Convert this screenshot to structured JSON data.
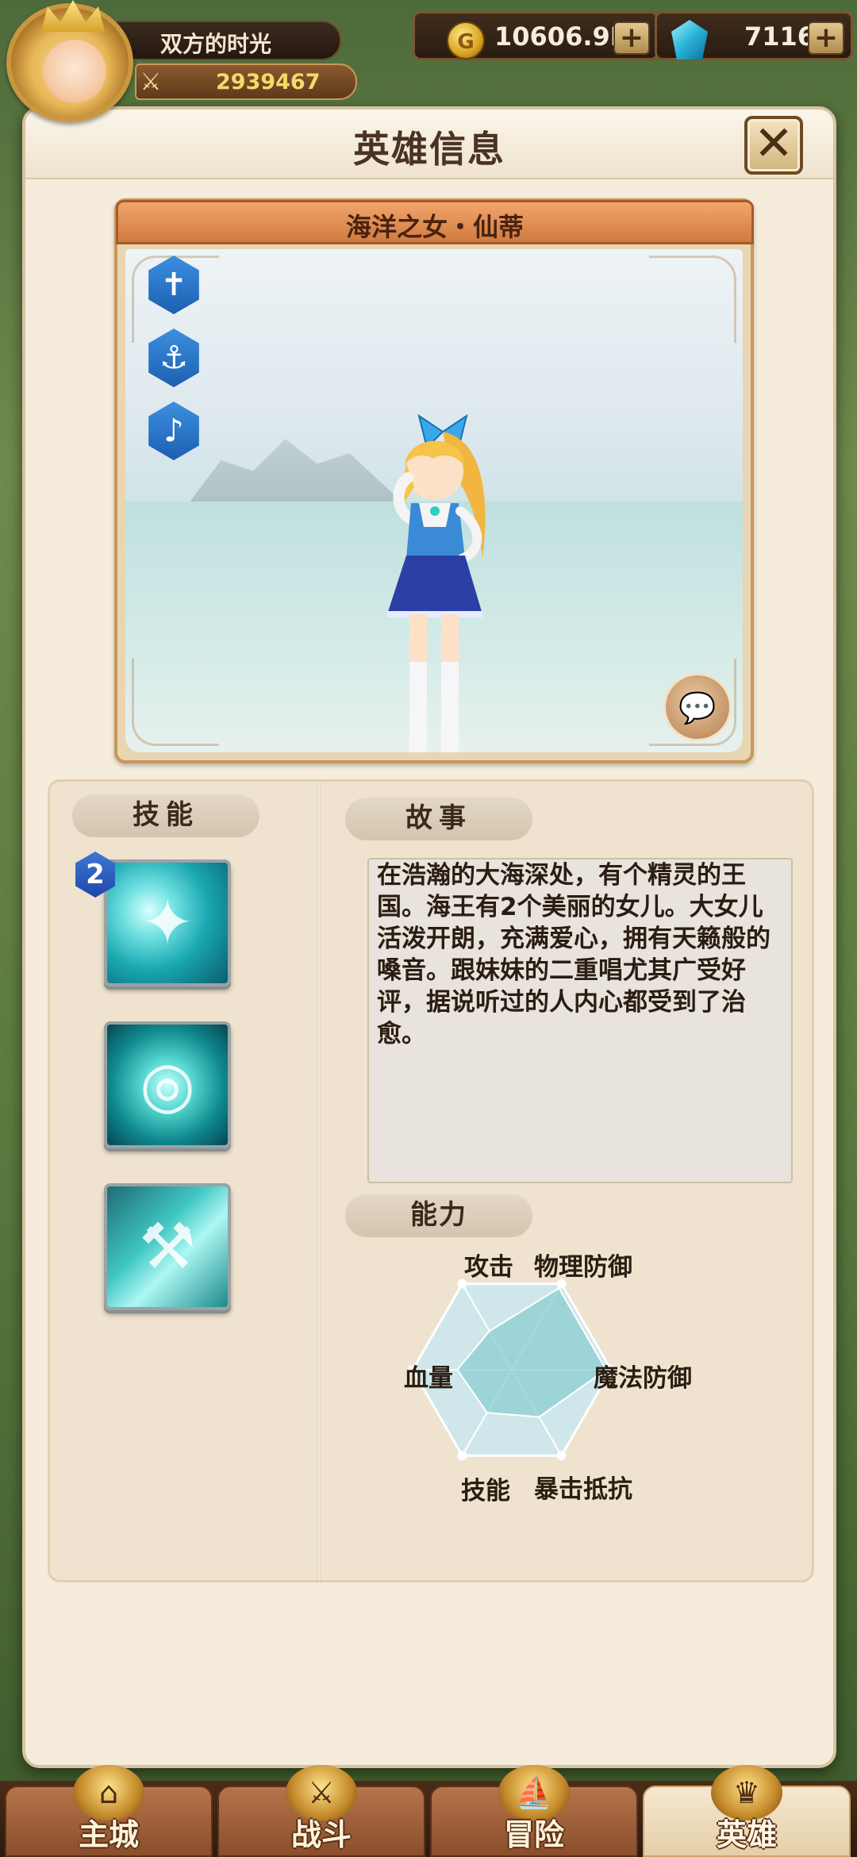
{
  "player": {
    "name": "双方的时光",
    "power": "2939467"
  },
  "resources": {
    "gold": "10606.9K",
    "gems": "7116",
    "plus": "+"
  },
  "modal": {
    "title": "英雄信息",
    "close": "✕"
  },
  "hero": {
    "name": "海洋之女・仙蒂",
    "traits": [
      "cross-icon",
      "anchor-icon",
      "music-note-icon"
    ]
  },
  "skills": {
    "header": "技能",
    "items": [
      {
        "level": "2",
        "icon": "water-swirl-icon"
      },
      {
        "icon": "water-orb-icon"
      },
      {
        "icon": "hammer-wave-icon"
      }
    ]
  },
  "story": {
    "header": "故事",
    "text": "在浩瀚的大海深处，有个精灵的王国。海王有2个美丽的女儿。大女儿活泼开朗，充满爱心，拥有天籁般的嗓音。跟妹妹的二重唱尤其广受好评，据说听过的人内心都受到了治愈。"
  },
  "abilities": {
    "header": "能力",
    "axes": [
      "攻击",
      "物理防御",
      "魔法防御",
      "暴击抵抗",
      "技能",
      "血量"
    ],
    "values": [
      0.45,
      0.95,
      0.95,
      0.55,
      0.5,
      0.55
    ]
  },
  "nav": {
    "tabs": [
      {
        "label": "主城",
        "active": false
      },
      {
        "label": "战斗",
        "active": false
      },
      {
        "label": "冒险",
        "active": false
      },
      {
        "label": "英雄",
        "active": true
      }
    ]
  }
}
